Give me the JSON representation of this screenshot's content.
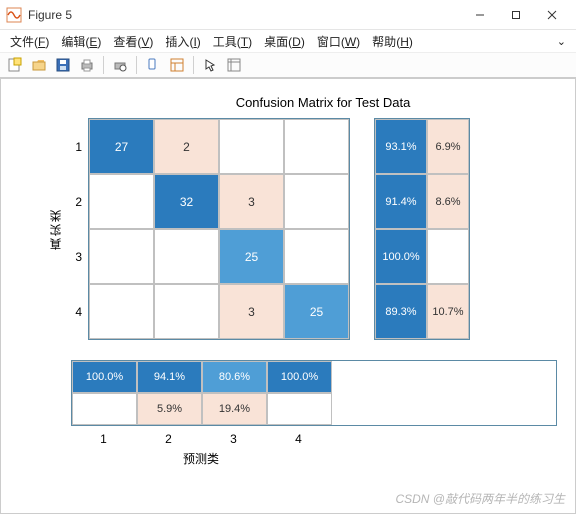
{
  "title": "Figure 5",
  "menu": {
    "file": {
      "label": "文件",
      "mn": "F"
    },
    "edit": {
      "label": "编辑",
      "mn": "E"
    },
    "view": {
      "label": "查看",
      "mn": "V"
    },
    "insert": {
      "label": "插入",
      "mn": "I"
    },
    "tools": {
      "label": "工具",
      "mn": "T"
    },
    "desktop": {
      "label": "桌面",
      "mn": "D"
    },
    "window": {
      "label": "窗口",
      "mn": "W"
    },
    "help": {
      "label": "帮助",
      "mn": "H"
    }
  },
  "chart_data": {
    "type": "heatmap",
    "title": "Confusion Matrix for Test Data",
    "xlabel": "预测类",
    "ylabel": "真实类",
    "row_labels": [
      "1",
      "2",
      "3",
      "4"
    ],
    "col_labels": [
      "1",
      "2",
      "3",
      "4"
    ],
    "matrix": [
      [
        27,
        2,
        null,
        null
      ],
      [
        null,
        32,
        3,
        null
      ],
      [
        null,
        null,
        25,
        null
      ],
      [
        null,
        null,
        3,
        25
      ]
    ],
    "row_summary": [
      {
        "correct_pct": "93.1%",
        "wrong_pct": "6.9%"
      },
      {
        "correct_pct": "91.4%",
        "wrong_pct": "8.6%"
      },
      {
        "correct_pct": "100.0%",
        "wrong_pct": ""
      },
      {
        "correct_pct": "89.3%",
        "wrong_pct": "10.7%"
      }
    ],
    "col_summary": [
      {
        "correct_pct": "100.0%",
        "wrong_pct": ""
      },
      {
        "correct_pct": "94.1%",
        "wrong_pct": "5.9%"
      },
      {
        "correct_pct": "80.6%",
        "wrong_pct": "19.4%"
      },
      {
        "correct_pct": "100.0%",
        "wrong_pct": ""
      }
    ],
    "cell_colors": [
      [
        "c-deep",
        "c-pale",
        "c-empty",
        "c-empty"
      ],
      [
        "c-empty",
        "c-deep",
        "c-pale",
        "c-empty"
      ],
      [
        "c-empty",
        "c-empty",
        "c-mid",
        "c-empty"
      ],
      [
        "c-empty",
        "c-empty",
        "c-pale",
        "c-mid"
      ]
    ],
    "row_summary_colors": [
      [
        "c-deep",
        "c-pale"
      ],
      [
        "c-deep",
        "c-pale"
      ],
      [
        "c-deep",
        "c-empty"
      ],
      [
        "c-deep",
        "c-pale"
      ]
    ],
    "col_summary_colors": [
      [
        "c-deep",
        "c-deep",
        "c-mid",
        "c-deep"
      ],
      [
        "c-empty",
        "c-pale",
        "c-pale",
        "c-empty"
      ]
    ]
  },
  "watermark": "CSDN @敲代码两年半的练习生"
}
